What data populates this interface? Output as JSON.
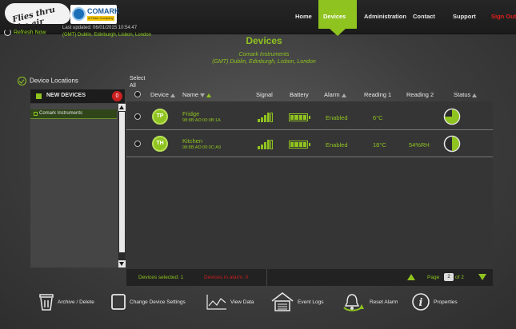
{
  "brand": {
    "slogan": "Flies thru the air",
    "logo_name": "COMARK",
    "logo_tagline": "A Fluke Company"
  },
  "header": {
    "refresh_label": "Refresh Now",
    "last_updated": "Last updated: 06/01/2015 10:54:47",
    "timezone": "(GMT) Dublin, Edinburgh, Lisbon, London"
  },
  "nav": {
    "items": [
      "Home",
      "Devices",
      "Administration",
      "Contact",
      "Support"
    ],
    "active": "Devices",
    "signout": "Sign Out"
  },
  "page": {
    "title": "Devices",
    "company": "Comark Instruments",
    "timezone": "(GMT) Dublin, Edinburgh, Lisbon, London"
  },
  "sidebar": {
    "heading": "Device Locations",
    "new_devices_label": "NEW DEVICES",
    "new_devices_count": "0",
    "locations": [
      "Comark Instruments"
    ]
  },
  "table": {
    "select_all": "Select All",
    "columns": [
      "Device",
      "Name",
      "Signal",
      "Battery",
      "Alarm",
      "Reading 1",
      "Reading 2",
      "Status"
    ],
    "rows": [
      {
        "device": "TP",
        "name": "Fridge",
        "mac": "98:8B:AD:00:0B:1A",
        "alarm": "Enabled",
        "reading1": "6°C",
        "reading2": "",
        "status_fraction": 0.75,
        "signal_bars": 4,
        "battery_bars": 4
      },
      {
        "device": "TH",
        "name": "Kitchen",
        "mac": "98:8B:AD:00:0C:A9",
        "alarm": "Enabled",
        "reading1": "18°C",
        "reading2": "54%RH",
        "status_fraction": 0.5,
        "signal_bars": 4,
        "battery_bars": 4
      }
    ]
  },
  "status_bar": {
    "selected": "Devices selected: 1",
    "alarms": "Devices in alarm: 0",
    "page_label": "Page",
    "page_current": "2",
    "page_of": "of 2"
  },
  "toolbar": {
    "items": [
      "Archive / Delete",
      "Change Device Settings",
      "View Data",
      "Event Logs",
      "Reset Alarm",
      "Properties"
    ]
  },
  "colors": {
    "accent": "#8fc31f",
    "alert": "#cc1f1f"
  }
}
